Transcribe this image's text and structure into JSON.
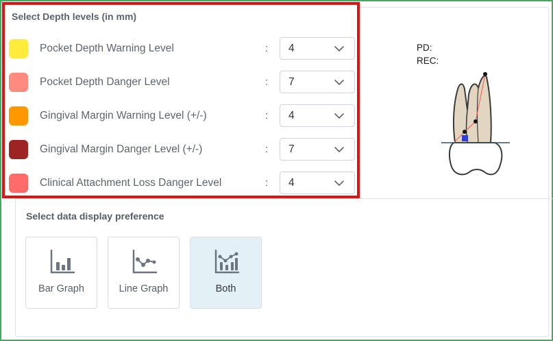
{
  "depth_levels": {
    "title": "Select Depth levels (in mm)",
    "separator": ":",
    "rows": [
      {
        "label": "Pocket Depth Warning Level",
        "value": "4",
        "color": "#ffeb3b"
      },
      {
        "label": "Pocket Depth Danger Level",
        "value": "7",
        "color": "#ff8a80"
      },
      {
        "label": "Gingival Margin Warning Level (+/-)",
        "value": "4",
        "color": "#ff9800"
      },
      {
        "label": "Gingival Margin Danger Level (+/-)",
        "value": "7",
        "color": "#9e2424"
      },
      {
        "label": "Clinical Attachment Loss Danger Level",
        "value": "4",
        "color": "#ff6b6b"
      }
    ]
  },
  "tooth_preview": {
    "pd_label": "PD:",
    "rec_label": "REC:"
  },
  "display_preference": {
    "title": "Select data display preference",
    "options": [
      {
        "label": "Bar Graph",
        "icon": "bar-graph-icon",
        "selected": false
      },
      {
        "label": "Line Graph",
        "icon": "line-graph-icon",
        "selected": false
      },
      {
        "label": "Both",
        "icon": "both-graph-icon",
        "selected": true
      }
    ]
  },
  "colors": {
    "highlight_border": "#e01313",
    "frame_border": "#3fae5a",
    "selected_bg": "#e3f1f6",
    "icon_color": "#6b7480"
  }
}
